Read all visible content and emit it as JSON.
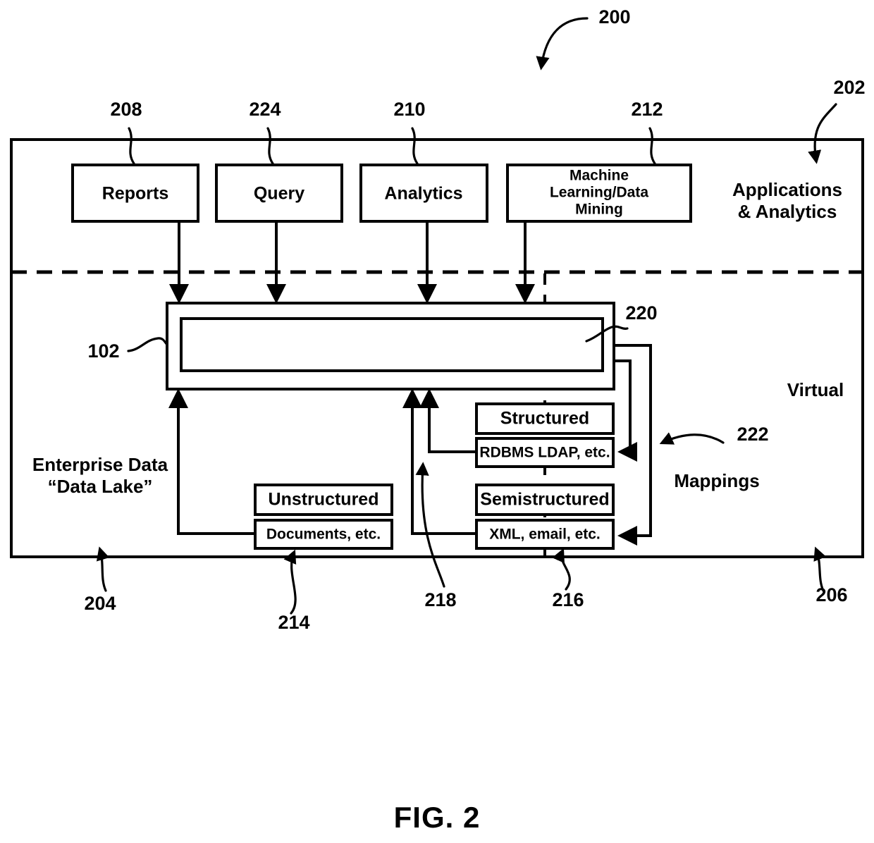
{
  "figure": {
    "caption": "FIG. 2",
    "root_ref": "200"
  },
  "regions": {
    "applications": {
      "label_line1": "Applications",
      "label_line2": "& Analytics",
      "ref": "202"
    },
    "enterprise": {
      "label_line1": "Enterprise Data",
      "label_line2": "“Data Lake”",
      "ref": "204"
    },
    "virtual": {
      "label": "Virtual",
      "ref": "206"
    },
    "mappings": {
      "label": "Mappings",
      "ref": "222"
    }
  },
  "app_boxes": [
    {
      "label": "Reports",
      "ref": "208"
    },
    {
      "label": "Query",
      "ref": "224"
    },
    {
      "label": "Analytics",
      "ref": "210"
    },
    {
      "label_line1": "Machine",
      "label_line2": "Learning/Data",
      "label_line3": "Mining",
      "ref": "212"
    }
  ],
  "core": {
    "outer_ref": "102",
    "inner_ref": "220"
  },
  "sources": {
    "unstructured": {
      "header": "Unstructured",
      "detail": "Documents, etc.",
      "ref": "214"
    },
    "structured": {
      "header": "Structured",
      "detail": "RDBMS LDAP, etc.",
      "ref": "218"
    },
    "semistructured": {
      "header": "Semistructured",
      "detail": "XML, email, etc.",
      "ref": "216"
    }
  },
  "colors": {
    "ink": "#000000",
    "paper": "#ffffff"
  }
}
